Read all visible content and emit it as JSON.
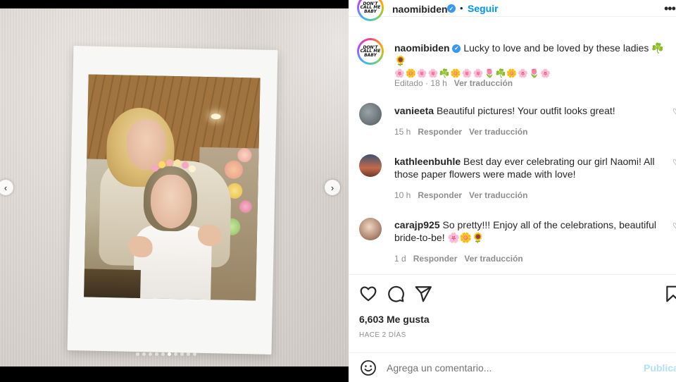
{
  "header": {
    "avatar_text": "DON'T CALL ME BABY",
    "username": "naomibiden",
    "separator": "•",
    "follow_label": "Seguir",
    "more_icon": "more-horizontal-icon"
  },
  "caption": {
    "username": "naomibiden",
    "text": "Lucky to love and be loved by these ladies ☘️🌻",
    "emoji_line": "🌸🌼🌸🌸☘️🌼🌸🌸🌷☘️🌼🌸🌷🌸",
    "edited": "Editado",
    "dot": "·",
    "time": "18 h",
    "translate": "Ver traducción"
  },
  "comments": [
    {
      "username": "vanieeta",
      "text": "Beautiful pictures! Your outfit looks great!",
      "time": "15 h",
      "reply": "Responder",
      "translate": "Ver traducción"
    },
    {
      "username": "kathleenbuhle",
      "text": "Best day ever celebrating our girl Naomi! All those paper flowers were made with love!",
      "time": "10 h",
      "reply": "Responder",
      "translate": "Ver traducción"
    },
    {
      "username": "carajp925",
      "text": "So pretty!!! Enjoy all of the celebrations, beautiful bride-to-be! 🌸🌼🌻",
      "time": "1 d",
      "reply": "Responder",
      "translate": "Ver traducción"
    }
  ],
  "actions": {
    "like_icon": "heart-icon",
    "comment_icon": "comment-icon",
    "share_icon": "send-icon",
    "save_icon": "bookmark-icon",
    "likes_count": "6,603",
    "likes_label": "Me gusta",
    "date": "HACE 2 DÍAS"
  },
  "add_comment": {
    "emoji_icon": "smiley-icon",
    "placeholder": "Agrega un comentario...",
    "publish_label": "Publicar"
  },
  "carousel": {
    "prev_icon": "chevron-left-icon",
    "next_icon": "chevron-right-icon",
    "total_slides": 10,
    "active_slide": 6
  },
  "colors": {
    "accent": "#0095f6",
    "verified": "#3897f0",
    "muted": "#8e8e8e",
    "publish_disabled": "#b2dffc"
  }
}
